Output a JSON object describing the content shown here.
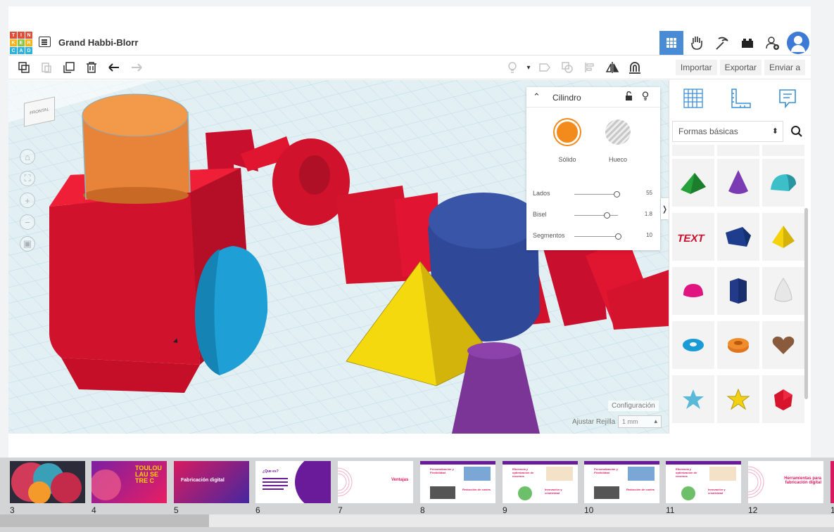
{
  "header": {
    "logo_letters": [
      "T",
      "I",
      "N",
      "K",
      "E",
      "R",
      "C",
      "A",
      "D"
    ],
    "title": "Grand Habbi-Blorr",
    "icons": [
      "grid-view-icon",
      "hand-icon",
      "pickaxe-icon",
      "bricks-icon",
      "add-user-icon",
      "avatar"
    ]
  },
  "toolbar": {
    "importar": "Importar",
    "exportar": "Exportar",
    "enviar": "Enviar a"
  },
  "viewcube": {
    "face_label": "FRONTAL"
  },
  "inspector": {
    "title": "Cilindro",
    "solid_label": "Sólido",
    "hole_label": "Hueco",
    "solid_color": "#f28a1c",
    "params": [
      {
        "label": "Lados",
        "value": "55",
        "fraction": 0.96
      },
      {
        "label": "Bisel",
        "value": "1.8",
        "fraction": 0.74
      },
      {
        "label": "Segmentos",
        "value": "10",
        "fraction": 1.0
      }
    ]
  },
  "workplane": {
    "config_label": "Configuración",
    "grid_label": "Ajustar Rejilla",
    "grid_value": "1 mm"
  },
  "shapes_panel": {
    "category": "Formas básicas",
    "tiles": [
      "wedge",
      "cone",
      "half-cylinder",
      "text",
      "polygon-prism",
      "pyramid",
      "half-sphere",
      "hexagonal-prism",
      "paraboloid",
      "torus",
      "tube",
      "heart",
      "star",
      "star-yellow",
      "icosahedron"
    ]
  },
  "filmstrip": {
    "slides": [
      {
        "num": "3"
      },
      {
        "num": "4",
        "text": "TOULOU LAU SE TRE C"
      },
      {
        "num": "5",
        "text": "Fabricación digital"
      },
      {
        "num": "6",
        "text": "¿Que es?"
      },
      {
        "num": "7",
        "text": "Ventajas"
      },
      {
        "num": "8",
        "text": "Personalización y Flexibilidad",
        "text2": "Reducción de costes"
      },
      {
        "num": "9",
        "text": "Eficiencia y optimización de recursos",
        "text2": "Innovación y creatividad"
      },
      {
        "num": "10",
        "text": "Personalización y Flexibilidad",
        "text2": "Reducción de costes"
      },
      {
        "num": "11",
        "text": "Eficiencia y optimización de recursos",
        "text2": "Innovación y creatividad"
      },
      {
        "num": "12",
        "text": "Herramientas para fabricación digital"
      },
      {
        "num": "1"
      }
    ]
  }
}
